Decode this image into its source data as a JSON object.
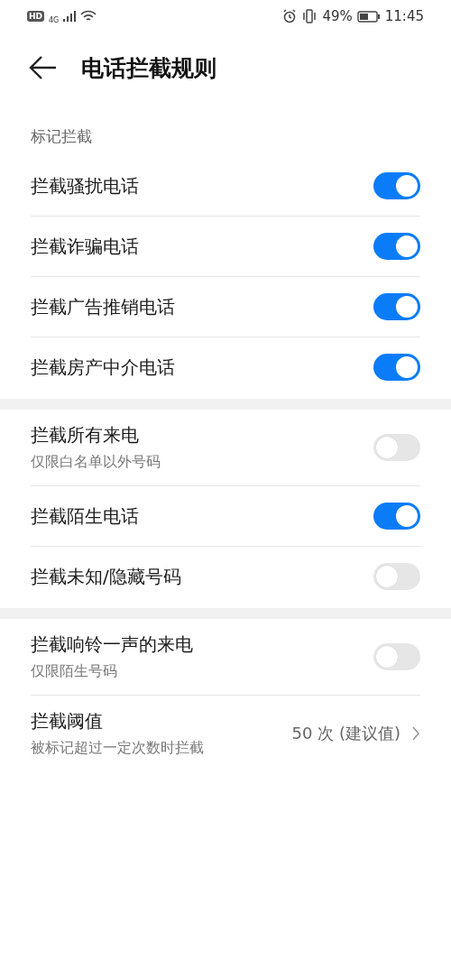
{
  "status_bar": {
    "hd": "HD",
    "network": "4G",
    "battery": "49%",
    "time": "11:45"
  },
  "header": {
    "title": "电话拦截规则"
  },
  "sections": [
    {
      "title": "标记拦截",
      "rows": [
        {
          "kind": "switch",
          "label": "拦截骚扰电话",
          "on": true
        },
        {
          "kind": "switch",
          "label": "拦截诈骗电话",
          "on": true
        },
        {
          "kind": "switch",
          "label": "拦截广告推销电话",
          "on": true
        },
        {
          "kind": "switch",
          "label": "拦截房产中介电话",
          "on": true
        }
      ]
    },
    {
      "rows": [
        {
          "kind": "switch",
          "label": "拦截所有来电",
          "subtitle": "仅限白名单以外号码",
          "on": false
        },
        {
          "kind": "switch",
          "label": "拦截陌生电话",
          "on": true
        },
        {
          "kind": "switch",
          "label": "拦截未知/隐藏号码",
          "on": false
        }
      ]
    },
    {
      "rows": [
        {
          "kind": "switch",
          "label": "拦截响铃一声的来电",
          "subtitle": "仅限陌生号码",
          "on": false
        },
        {
          "kind": "link",
          "label": "拦截阈值",
          "subtitle": "被标记超过一定次数时拦截",
          "value": "50 次 (建议值)"
        }
      ]
    }
  ]
}
